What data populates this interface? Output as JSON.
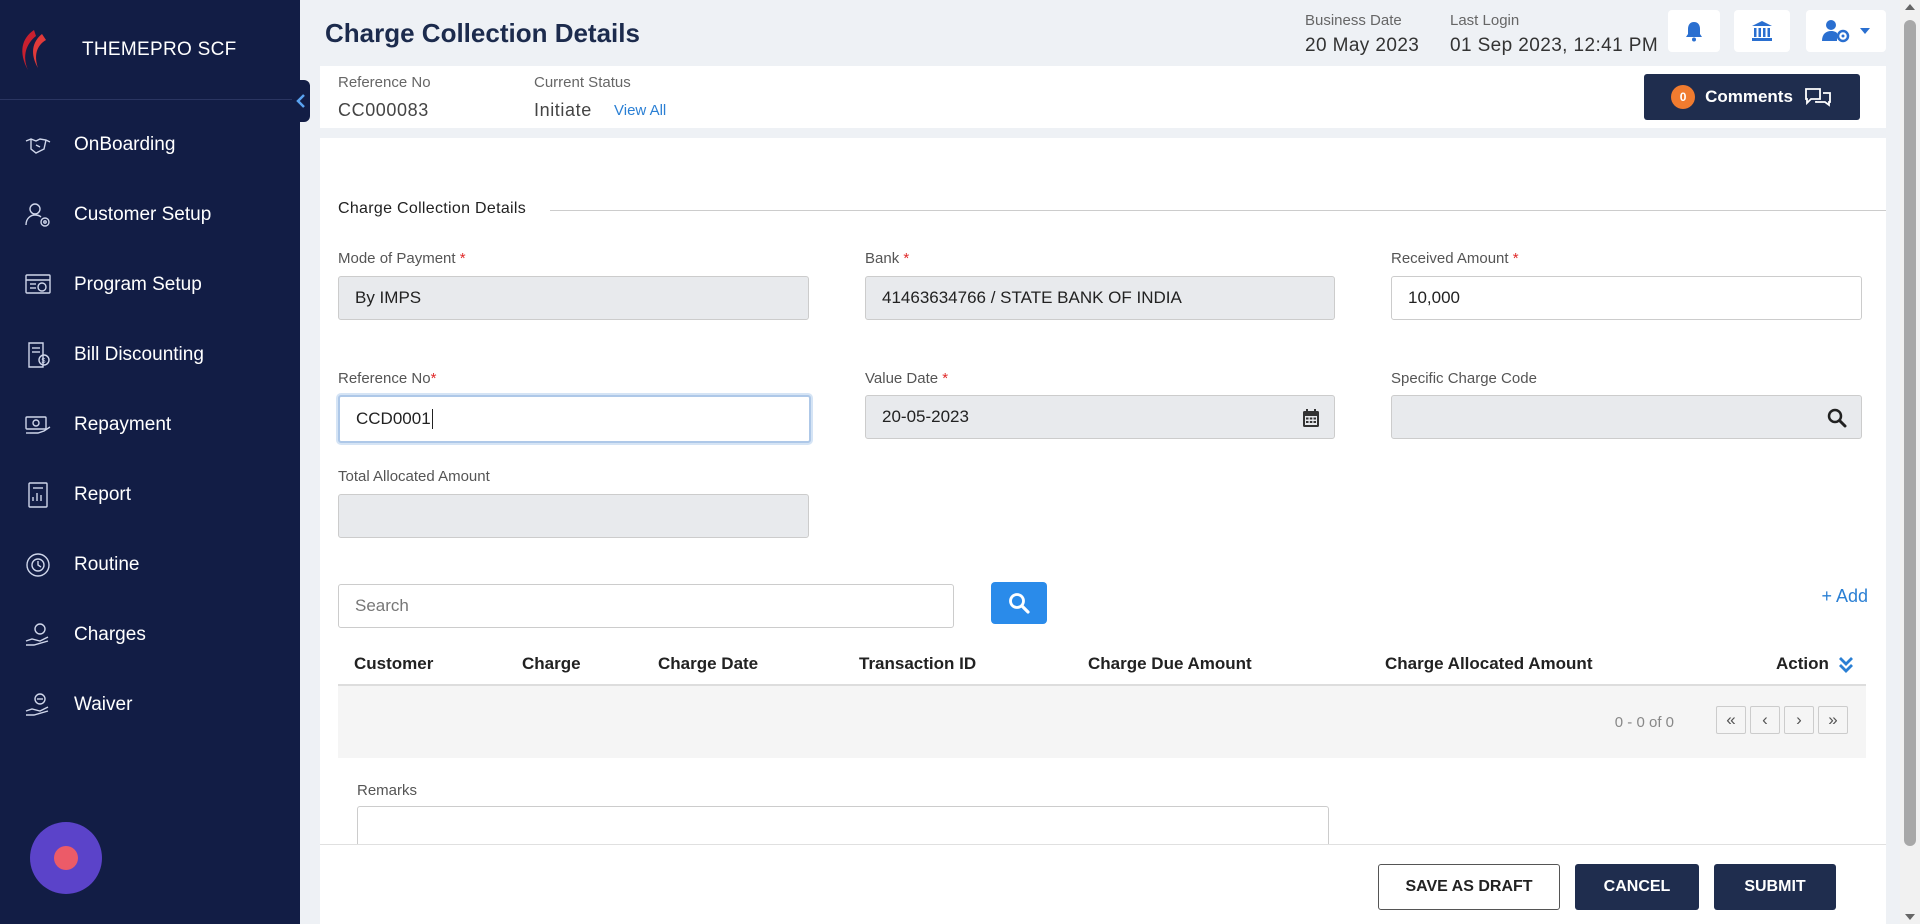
{
  "app": {
    "brand": "THEMEPRO SCF"
  },
  "sidebar": {
    "items": [
      {
        "label": "OnBoarding",
        "icon": "handshake-icon"
      },
      {
        "label": "Customer Setup",
        "icon": "user-gear-icon"
      },
      {
        "label": "Program Setup",
        "icon": "program-icon"
      },
      {
        "label": "Bill Discounting",
        "icon": "bill-icon"
      },
      {
        "label": "Repayment",
        "icon": "repayment-icon"
      },
      {
        "label": "Report",
        "icon": "report-icon"
      },
      {
        "label": "Routine",
        "icon": "routine-icon"
      },
      {
        "label": "Charges",
        "icon": "charges-icon"
      },
      {
        "label": "Waiver",
        "icon": "waiver-icon"
      }
    ]
  },
  "header": {
    "title": "Charge Collection Details",
    "business_date_label": "Business Date",
    "business_date": "20 May 2023",
    "last_login_label": "Last Login",
    "last_login": "01 Sep 2023, 12:41 PM"
  },
  "refbar": {
    "reference_label": "Reference No",
    "reference_value": "CC000083",
    "status_label": "Current Status",
    "status_value": "Initiate",
    "view_all": "View All",
    "comments_count": "0",
    "comments_label": "Comments"
  },
  "form": {
    "section_title": "Charge Collection Details",
    "mode_of_payment": {
      "label": "Mode of Payment",
      "value": "By IMPS"
    },
    "bank": {
      "label": "Bank",
      "value": "41463634766 / STATE BANK OF INDIA"
    },
    "received_amount": {
      "label": "Received Amount",
      "value": "10,000"
    },
    "reference_no": {
      "label": "Reference No",
      "value": "CCD0001"
    },
    "value_date": {
      "label": "Value Date",
      "value": "20-05-2023"
    },
    "specific_charge_code": {
      "label": "Specific Charge Code",
      "value": ""
    },
    "total_allocated_amount": {
      "label": "Total Allocated Amount",
      "value": ""
    },
    "required_mark": "*"
  },
  "table": {
    "search_placeholder": "Search",
    "add_label": "+ Add",
    "columns": [
      "Customer",
      "Charge",
      "Charge Date",
      "Transaction ID",
      "Charge Due Amount",
      "Charge Allocated Amount",
      "Action"
    ],
    "pager_text": "0 - 0 of 0",
    "pager_first": "«",
    "pager_prev": "‹",
    "pager_next": "›",
    "pager_last": "»"
  },
  "remarks": {
    "label": "Remarks"
  },
  "footer": {
    "save_draft": "SAVE AS DRAFT",
    "cancel": "CANCEL",
    "submit": "SUBMIT"
  },
  "colors": {
    "sidebar_bg": "#121d45",
    "primary_dark": "#1f2d4e",
    "accent_blue": "#2a8bea",
    "required_red": "#e02a2a",
    "badge_orange": "#f07b2f"
  }
}
